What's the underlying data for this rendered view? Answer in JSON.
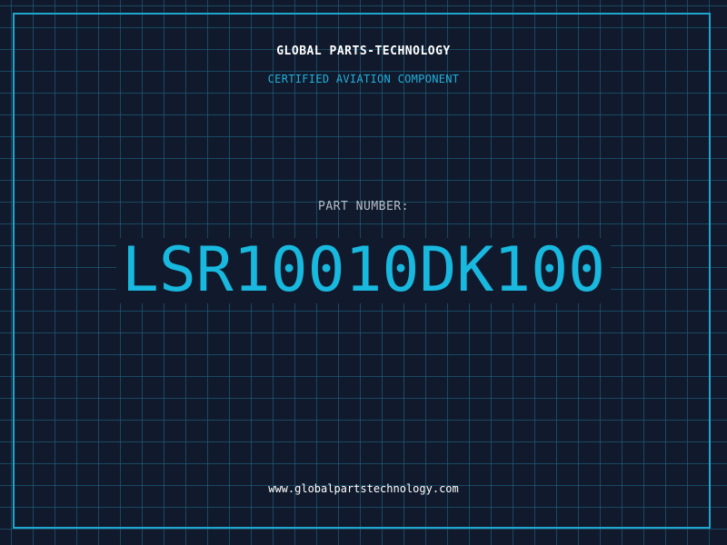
{
  "header": {
    "company": "GLOBAL PARTS-TECHNOLOGY",
    "subtitle": "CERTIFIED AVIATION COMPONENT"
  },
  "part": {
    "label": "PART NUMBER:",
    "number": "LSR10010DK100"
  },
  "footer": {
    "url": "www.globalpartstechnology.com"
  },
  "colors": {
    "background": "#111a2c",
    "grid": "#1e6e8c",
    "accent": "#1fa6cf",
    "part_number": "#18b8df",
    "text_primary": "#ffffff",
    "text_muted": "#b6bcc6"
  }
}
